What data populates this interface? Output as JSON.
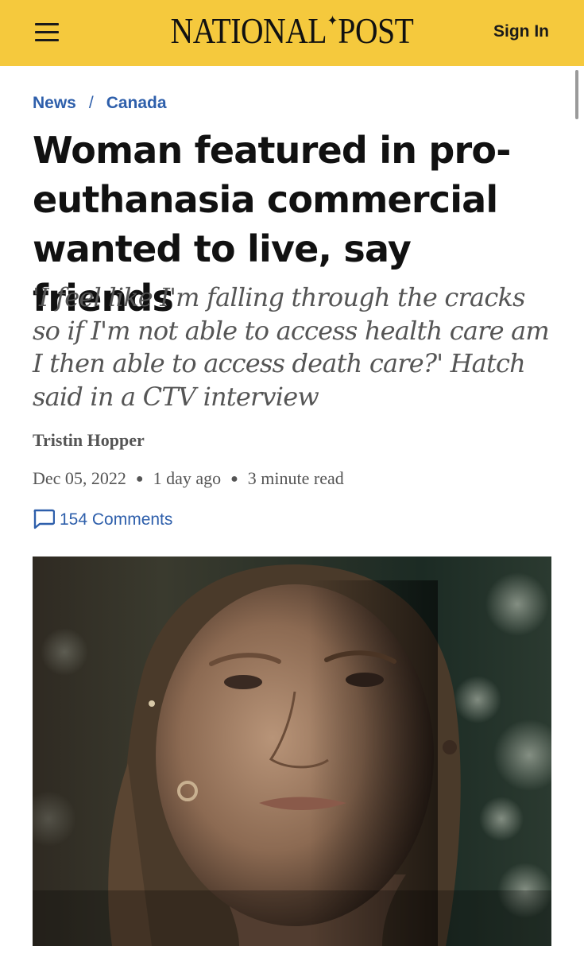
{
  "header": {
    "logo_left": "NATIONAL",
    "logo_right": "POST",
    "logo_icon": "maple-leaf-icon",
    "menu_icon": "hamburger-menu-icon",
    "signin_label": "Sign In",
    "bar_color": "#f5c93d"
  },
  "breadcrumb": {
    "items": [
      "News",
      "Canada"
    ],
    "separator": "/",
    "link_color": "#2e5fab"
  },
  "article": {
    "headline": "Woman featured in pro-euthanasia commercial wanted to live, say friends",
    "dek": "'I feel like I'm falling through the cracks so if I'm not able to access health care am I then able to access death care?' Hatch said in a CTV interview",
    "author": "Tristin Hopper",
    "date": "Dec 05, 2022",
    "relative_time": "1 day ago",
    "read_time": "3 minute read",
    "comments_label": "154 Comments",
    "comments_icon": "speech-bubble-icon",
    "hero_image": "portrait-photo"
  }
}
